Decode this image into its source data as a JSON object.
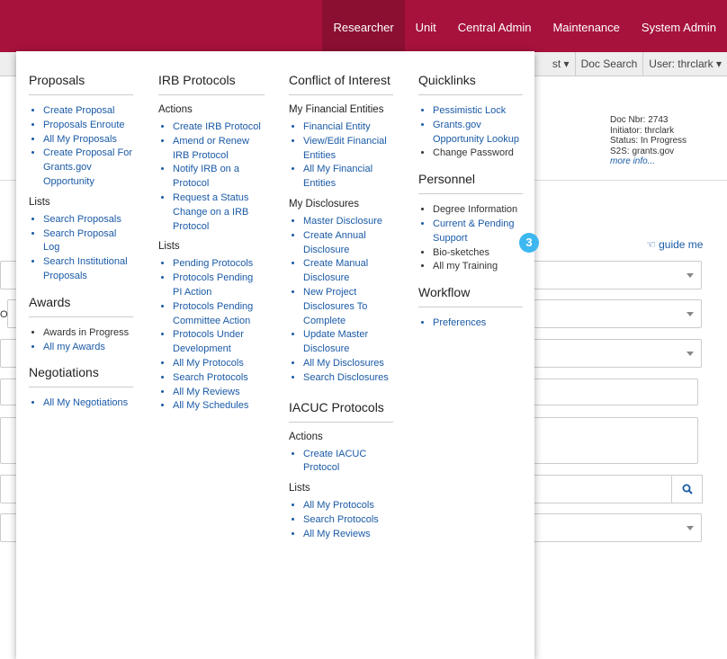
{
  "topnav": [
    "Researcher",
    "Unit",
    "Central Admin",
    "Maintenance",
    "System Admin"
  ],
  "subbar": {
    "fragment": "st ▾",
    "doc_search": "Doc Search",
    "user": "User: thrclark ▾"
  },
  "docinfo": {
    "doc_nbr": "Doc Nbr: 2743",
    "initiator": "Initiator: thrclark",
    "status": "Status: In Progress",
    "s2s": "S2S: grants.gov",
    "more": "more info..."
  },
  "guide": "guide me",
  "fragment_label": "O",
  "badge": "3",
  "menu": {
    "proposals": {
      "title": "Proposals",
      "items": [
        "Create Proposal",
        "Proposals Enroute",
        "All My Proposals",
        "Create Proposal For Grants.gov Opportunity"
      ],
      "lists_heading": "Lists",
      "lists": [
        "Search Proposals",
        "Search Proposal Log",
        "Search Institutional Proposals"
      ]
    },
    "awards": {
      "title": "Awards",
      "items": [
        "Awards in Progress",
        "All my Awards"
      ]
    },
    "negotiations": {
      "title": "Negotiations",
      "items": [
        "All My Negotiations"
      ]
    },
    "irb": {
      "title": "IRB Protocols",
      "actions_heading": "Actions",
      "actions": [
        "Create IRB Protocol",
        "Amend or Renew IRB Protocol",
        "Notify IRB on a Protocol",
        "Request a Status Change on a IRB Protocol"
      ],
      "lists_heading": "Lists",
      "lists": [
        "Pending Protocols",
        "Protocols Pending PI Action",
        "Protocols Pending Committee Action",
        "Protocols Under Development",
        "All My Protocols",
        "Search Protocols",
        "All My Reviews",
        "All My Schedules"
      ]
    },
    "coi": {
      "title": "Conflict of Interest",
      "fin_heading": "My Financial Entities",
      "fin": [
        "Financial Entity",
        "View/Edit Financial Entities",
        "All My Financial Entities"
      ],
      "disc_heading": "My Disclosures",
      "disc": [
        "Master Disclosure",
        "Create Annual Disclosure",
        "Create Manual Disclosure",
        "New Project Disclosures To Complete",
        "Update Master Disclosure",
        "All My Disclosures",
        "Search Disclosures"
      ]
    },
    "iacuc": {
      "title": "IACUC Protocols",
      "actions_heading": "Actions",
      "actions": [
        "Create IACUC Protocol"
      ],
      "lists_heading": "Lists",
      "lists": [
        "All My Protocols",
        "Search Protocols",
        "All My Reviews"
      ]
    },
    "quicklinks": {
      "title": "Quicklinks",
      "items": [
        "Pessimistic Lock",
        "Grants.gov Opportunity Lookup",
        "Change Password"
      ]
    },
    "personnel": {
      "title": "Personnel",
      "items": [
        "Degree Information",
        "Current & Pending Support",
        "Bio-sketches",
        "All my Training"
      ]
    },
    "workflow": {
      "title": "Workflow",
      "items": [
        "Preferences"
      ]
    }
  }
}
